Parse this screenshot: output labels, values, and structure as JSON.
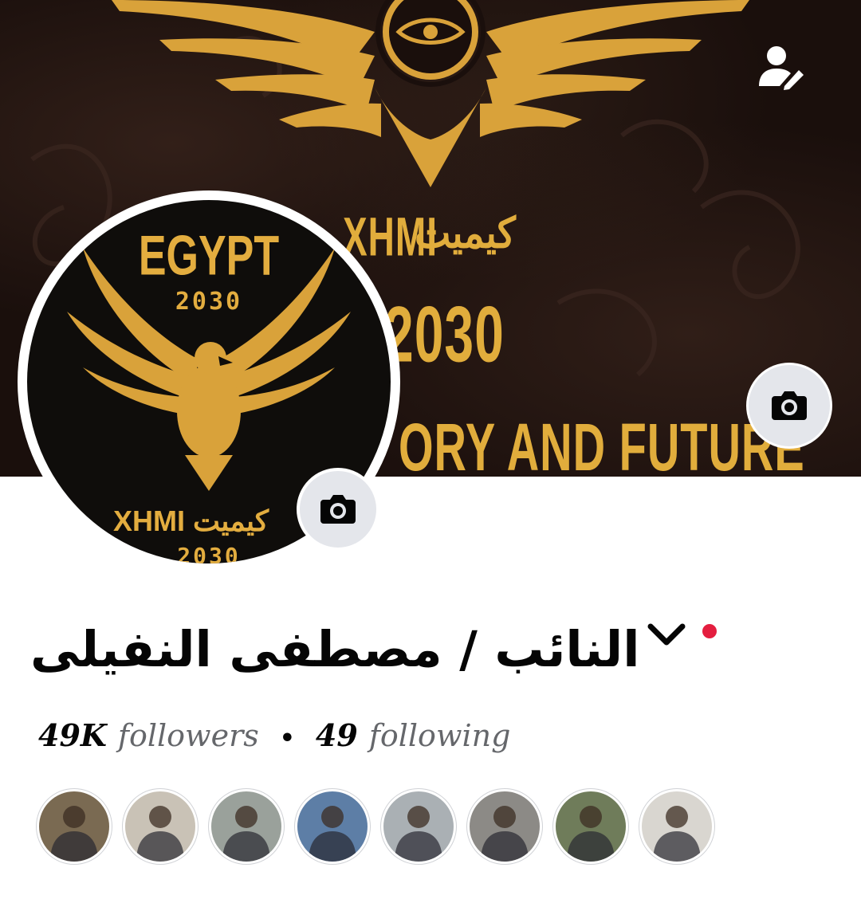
{
  "cover": {
    "text_arabic": "كيميت",
    "text_latin": "XHMI",
    "year": "2030",
    "tagline": "ORY AND FUTURE",
    "gold": "#e1ad3c"
  },
  "actions": {
    "edit_profile_icon": "person-edit-icon",
    "cover_camera_icon": "camera-icon",
    "avatar_camera_icon": "camera-icon"
  },
  "avatar": {
    "title": "EGYPT",
    "year_top": "2030",
    "brand_latin": "XHMI",
    "brand_arabic": "كيميت",
    "year_bottom": "2030"
  },
  "profile": {
    "name": "النائب / مصطفى النفيلى",
    "chevron_icon": "chevron-down-icon",
    "status_color": "#e41e3f"
  },
  "stats": {
    "followers_count": "49K",
    "followers_label": "followers",
    "separator": "•",
    "following_count": "49",
    "following_label": "following"
  },
  "friends": [
    {
      "name": "friend-avatar-1",
      "bg": "#7a6a52"
    },
    {
      "name": "friend-avatar-2",
      "bg": "#c9c2b6"
    },
    {
      "name": "friend-avatar-3",
      "bg": "#9aa19b"
    },
    {
      "name": "friend-avatar-4",
      "bg": "#5d7ea6"
    },
    {
      "name": "friend-avatar-5",
      "bg": "#aab0b4"
    },
    {
      "name": "friend-avatar-6",
      "bg": "#8c8a86"
    },
    {
      "name": "friend-avatar-7",
      "bg": "#6f7c5a"
    },
    {
      "name": "friend-avatar-8",
      "bg": "#d9d6d0"
    }
  ]
}
